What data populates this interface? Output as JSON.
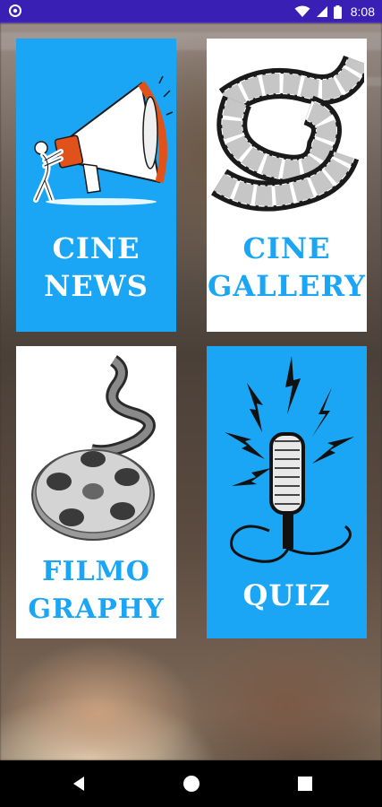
{
  "status_bar": {
    "time": "8:08",
    "icons": [
      "app-notification-icon",
      "wifi-icon",
      "signal-icon",
      "battery-icon"
    ]
  },
  "cards": [
    {
      "id": "cine-news",
      "label_line1": "CINE",
      "label_line2": "NEWS",
      "background": "#1aa6f4",
      "text_color": "#ffffff",
      "icon": "megaphone-icon"
    },
    {
      "id": "cine-gallery",
      "label_line1": "CINE",
      "label_line2": "GALLERY",
      "background": "#ffffff",
      "text_color": "#1aa6f4",
      "icon": "film-strip-icon"
    },
    {
      "id": "filmography",
      "label_line1": "FILMO",
      "label_line2": "GRAPHY",
      "background": "#ffffff",
      "text_color": "#1aa6f4",
      "icon": "film-reel-icon"
    },
    {
      "id": "quiz",
      "label_line1": "QUIZ",
      "label_line2": "",
      "background": "#1aa6f4",
      "text_color": "#ffffff",
      "icon": "microphone-icon"
    }
  ],
  "nav_bar": {
    "buttons": [
      "back-icon",
      "home-icon",
      "recents-icon"
    ]
  }
}
